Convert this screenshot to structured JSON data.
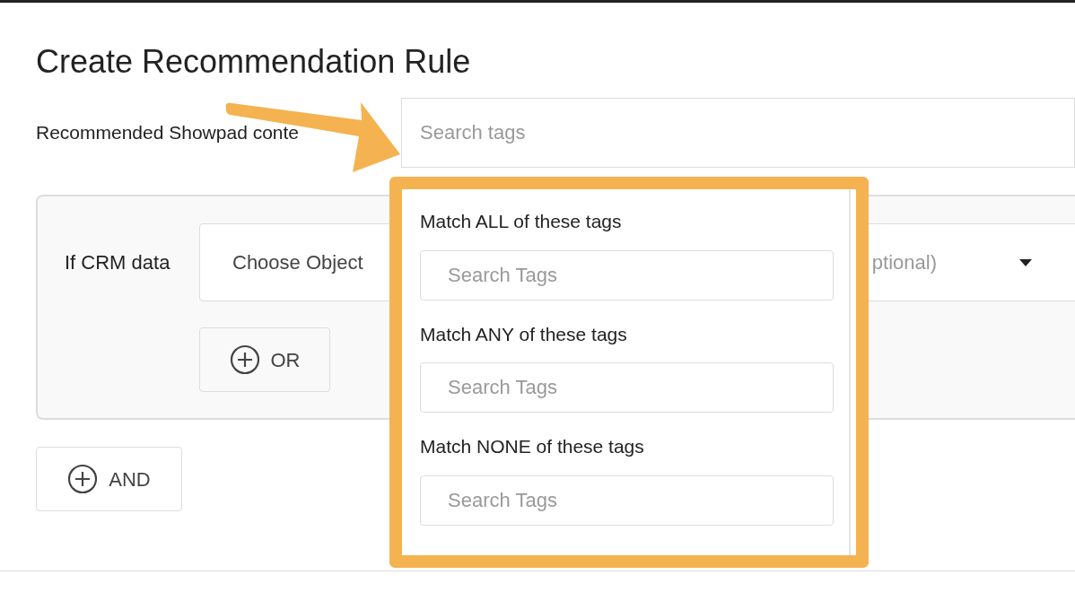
{
  "title": "Create Recommendation Rule",
  "content_field": {
    "label": "Recommended Showpad conte",
    "placeholder": "Search tags"
  },
  "condition": {
    "label": "If CRM data",
    "object_select": "Choose Object",
    "field_select": "ptional)",
    "or_button": "OR"
  },
  "and_button": "AND",
  "tag_dropdown": {
    "sections": [
      {
        "label": "Match ALL of these tags",
        "placeholder": "Search Tags"
      },
      {
        "label": "Match ANY of these tags",
        "placeholder": "Search Tags"
      },
      {
        "label": "Match NONE of these tags",
        "placeholder": "Search Tags"
      }
    ]
  }
}
